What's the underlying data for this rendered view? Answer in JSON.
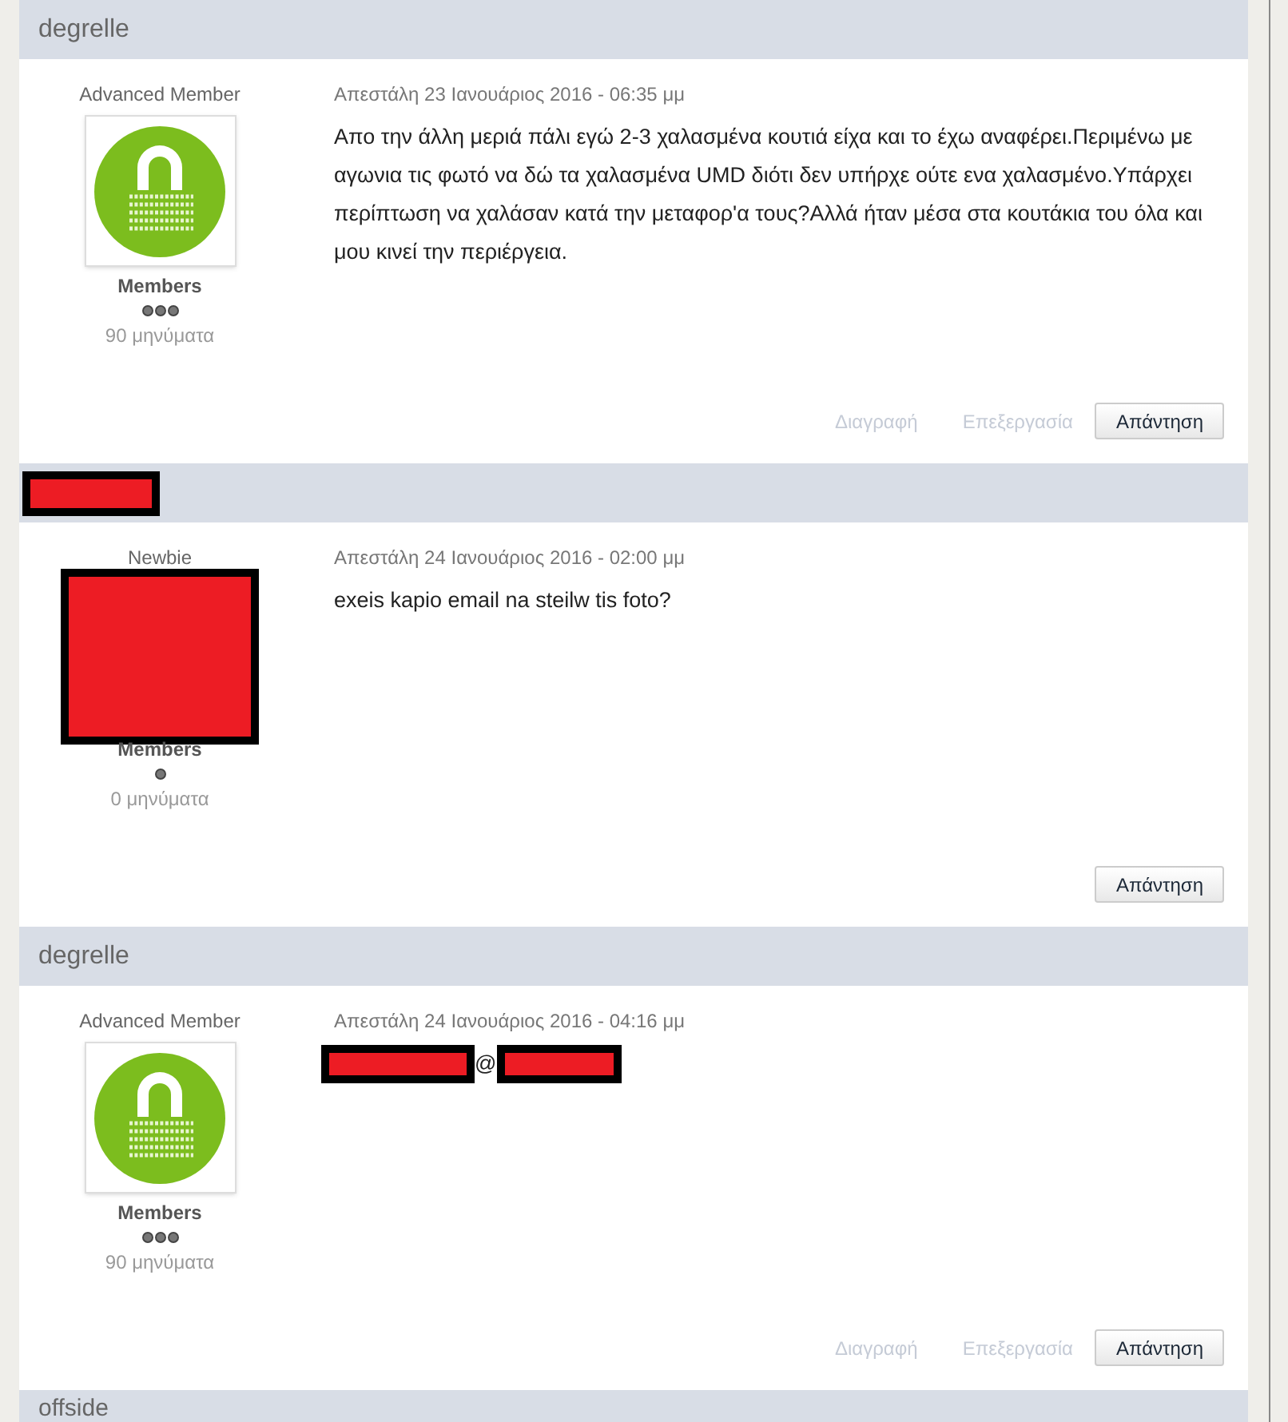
{
  "posts": [
    {
      "author": {
        "kind": "text",
        "name": "degrelle"
      },
      "title": "Advanced Member",
      "avatar": {
        "kind": "lock"
      },
      "group": "Members",
      "rank_pips": [
        {
          "filled": true
        },
        {
          "filled": true
        },
        {
          "filled": true
        }
      ],
      "count": "90 μηνύματα",
      "date": "Απεστάλη 23 Ιανουάριος 2016 - 06:35 μμ",
      "body": [
        {
          "kind": "text",
          "text": "Απο την άλλη μεριά πάλι εγώ 2-3 χαλασμένα κουτιά είχα και το έχω αναφέρει.Περιμένω με αγωνια τις φωτό να δώ τα χαλασμένα UMD διότι δεν υπήρχε ούτε ενα χαλασμένο.Υπάρχει περίπτωση να χαλάσαν κατά την μεταφορ'α τους?Αλλά ήταν μέσα στα κουτάκια του όλα και μου κινεί την περιέργεια."
        }
      ],
      "actions": [
        {
          "kind": "link",
          "label": "Διαγραφή"
        },
        {
          "kind": "link",
          "label": "Επεξεργασία"
        },
        {
          "kind": "button",
          "label": "Απάντηση"
        }
      ]
    },
    {
      "author": {
        "kind": "redacted"
      },
      "title": "Newbie",
      "avatar": {
        "kind": "redacted"
      },
      "group": "Members",
      "rank_pips": [
        {
          "filled": true
        }
      ],
      "count": "0 μηνύματα",
      "date": "Απεστάλη 24 Ιανουάριος 2016 - 02:00 μμ",
      "body": [
        {
          "kind": "text",
          "text": "exeis kapio email na steilw tis foto?"
        }
      ],
      "actions": [
        {
          "kind": "button",
          "label": "Απάντηση"
        }
      ]
    },
    {
      "author": {
        "kind": "text",
        "name": "degrelle"
      },
      "title": "Advanced Member",
      "avatar": {
        "kind": "lock"
      },
      "group": "Members",
      "rank_pips": [
        {
          "filled": true
        },
        {
          "filled": true
        },
        {
          "filled": true
        }
      ],
      "count": "90 μηνύματα",
      "date": "Απεστάλη 24 Ιανουάριος 2016 - 04:16 μμ",
      "body": [
        {
          "kind": "redacted"
        },
        {
          "kind": "text",
          "text": "@"
        },
        {
          "kind": "redacted"
        }
      ],
      "actions": [
        {
          "kind": "link",
          "label": "Διαγραφή"
        },
        {
          "kind": "link",
          "label": "Επεξεργασία"
        },
        {
          "kind": "button",
          "label": "Απάντηση"
        }
      ]
    }
  ],
  "next_author": "offside"
}
